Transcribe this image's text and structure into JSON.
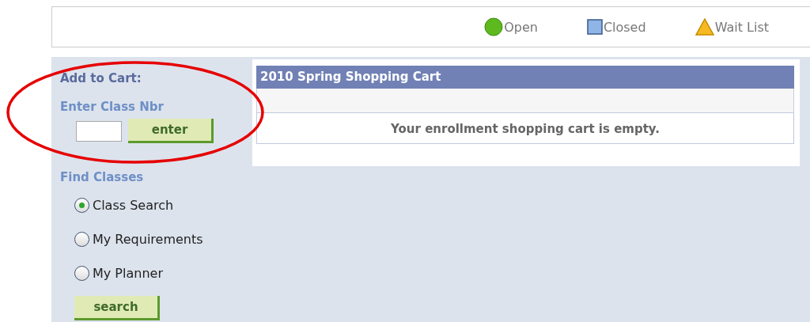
{
  "legend": [
    {
      "kind": "circle",
      "label": "Open",
      "color": "#5db91d"
    },
    {
      "kind": "square",
      "label": "Closed",
      "color": "#8fb4e6"
    },
    {
      "kind": "triangle",
      "label": "Wait List",
      "color": "#f5b921"
    }
  ],
  "sidebar": {
    "title": "Add to Cart:",
    "class_nbr_label": "Enter Class Nbr",
    "enter_button": "enter",
    "find_label": "Find Classes",
    "options": [
      {
        "label": "Class Search",
        "selected": true
      },
      {
        "label": "My Requirements",
        "selected": false
      },
      {
        "label": "My Planner",
        "selected": false
      }
    ],
    "search_button": "search"
  },
  "cart": {
    "title": "2010 Spring Shopping Cart",
    "message": "Your enrollment shopping cart is empty."
  }
}
